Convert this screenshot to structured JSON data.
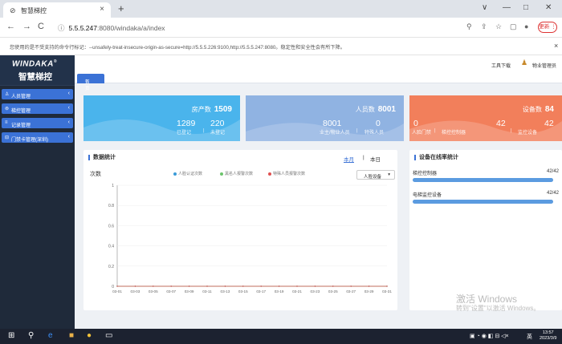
{
  "browser": {
    "tab_title": "智慧梯控",
    "tab_close": "×",
    "new_tab": "+",
    "url_host": "5.5.5.247",
    "url_rest": ":8080/windaka/a/index",
    "update_label": "更新 ⋮",
    "min": "∨",
    "minimize": "—",
    "restore": "□",
    "close": "✕"
  },
  "infobar": {
    "message": "您使用的是不受支持的命令行标记：--unsafely-treat-insecure-origin-as-secure=http://5.5.5.226:9100,http://5.5.5.247:8080。稳定性和安全性会有所下降。",
    "close": "×"
  },
  "app": {
    "brand": "WINDAKA",
    "brand_reg": "®",
    "brand_sub": "智慧梯控",
    "menu": [
      {
        "icon": "♙",
        "label": "人员管理",
        "arrow": "‹"
      },
      {
        "icon": "⊚",
        "label": "梯控管理",
        "arrow": "‹"
      },
      {
        "icon": "≡",
        "label": "记录管理",
        "arrow": "‹"
      },
      {
        "icon": "⊟",
        "label": "门禁卡管理(深圳)",
        "arrow": "‹"
      }
    ],
    "tool_label": "工具下载",
    "user_label": "物业管理员",
    "home_tab": "首页"
  },
  "cards": {
    "house": {
      "title": "房产数",
      "total": "1509",
      "n1": "1289",
      "n2": "220",
      "l1": "已登记",
      "l2": "未登记"
    },
    "person": {
      "title": "人员数",
      "total": "8001",
      "n1": "8001",
      "n2": "0",
      "l1": "业主/物业人员",
      "l2": "特殊人员"
    },
    "device": {
      "title": "设备数",
      "total": "84",
      "n1": "0",
      "n2": "42",
      "n3": "42",
      "l1": "人脸门禁",
      "l2": "梯控控制器",
      "l3": "监控设备"
    }
  },
  "stats_panel": {
    "title": "数据统计",
    "seg_month": "本月",
    "seg_sep": "|",
    "seg_day": "本日",
    "y_title": "次数",
    "select_label": "人脸设备",
    "select_chev": "▾"
  },
  "online_panel": {
    "title": "设备在线率统计",
    "rows": [
      {
        "label": "梯控控制器",
        "value": "42/42",
        "ratio": 1.0
      },
      {
        "label": "电梯监控设备",
        "value": "42/42",
        "ratio": 1.0
      }
    ]
  },
  "watermark": {
    "line1": "激活 Windows",
    "line2": "转到\"设置\"以激活 Windows。"
  },
  "taskbar": {
    "time": "13:57",
    "date": "2023/3/9",
    "ime": "英"
  },
  "colors": {
    "accent": "#3b72d6",
    "card_house": "#4ab4ec",
    "card_person": "#90b3e2",
    "card_device": "#f27f5b"
  },
  "chart_data": {
    "type": "line",
    "title": "",
    "ylabel": "次数",
    "ylim": [
      0,
      1
    ],
    "yticks": [
      "0",
      "0.2",
      "0.4",
      "0.6",
      "0.8",
      "1"
    ],
    "categories": [
      "03-01",
      "03-03",
      "03-05",
      "03-07",
      "03-09",
      "03-11",
      "03-13",
      "03-15",
      "03-17",
      "03-19",
      "03-21",
      "03-23",
      "03-25",
      "03-27",
      "03-29",
      "03-31"
    ],
    "series": [
      {
        "name": "人脸认证次数",
        "color": "#3a9bd8",
        "values": [
          0,
          0,
          0,
          0,
          0,
          0,
          0,
          0,
          0,
          0,
          0,
          0,
          0,
          0,
          0,
          0
        ]
      },
      {
        "name": "黑名人报警次数",
        "color": "#6cc46c",
        "values": [
          0,
          0,
          0,
          0,
          0,
          0,
          0,
          0,
          0,
          0,
          0,
          0,
          0,
          0,
          0,
          0
        ]
      },
      {
        "name": "特殊人员报警次数",
        "color": "#e05050",
        "values": [
          0,
          0,
          0,
          0,
          0,
          0,
          0,
          0,
          0,
          0,
          0,
          0,
          0,
          0,
          0,
          0
        ]
      }
    ]
  }
}
